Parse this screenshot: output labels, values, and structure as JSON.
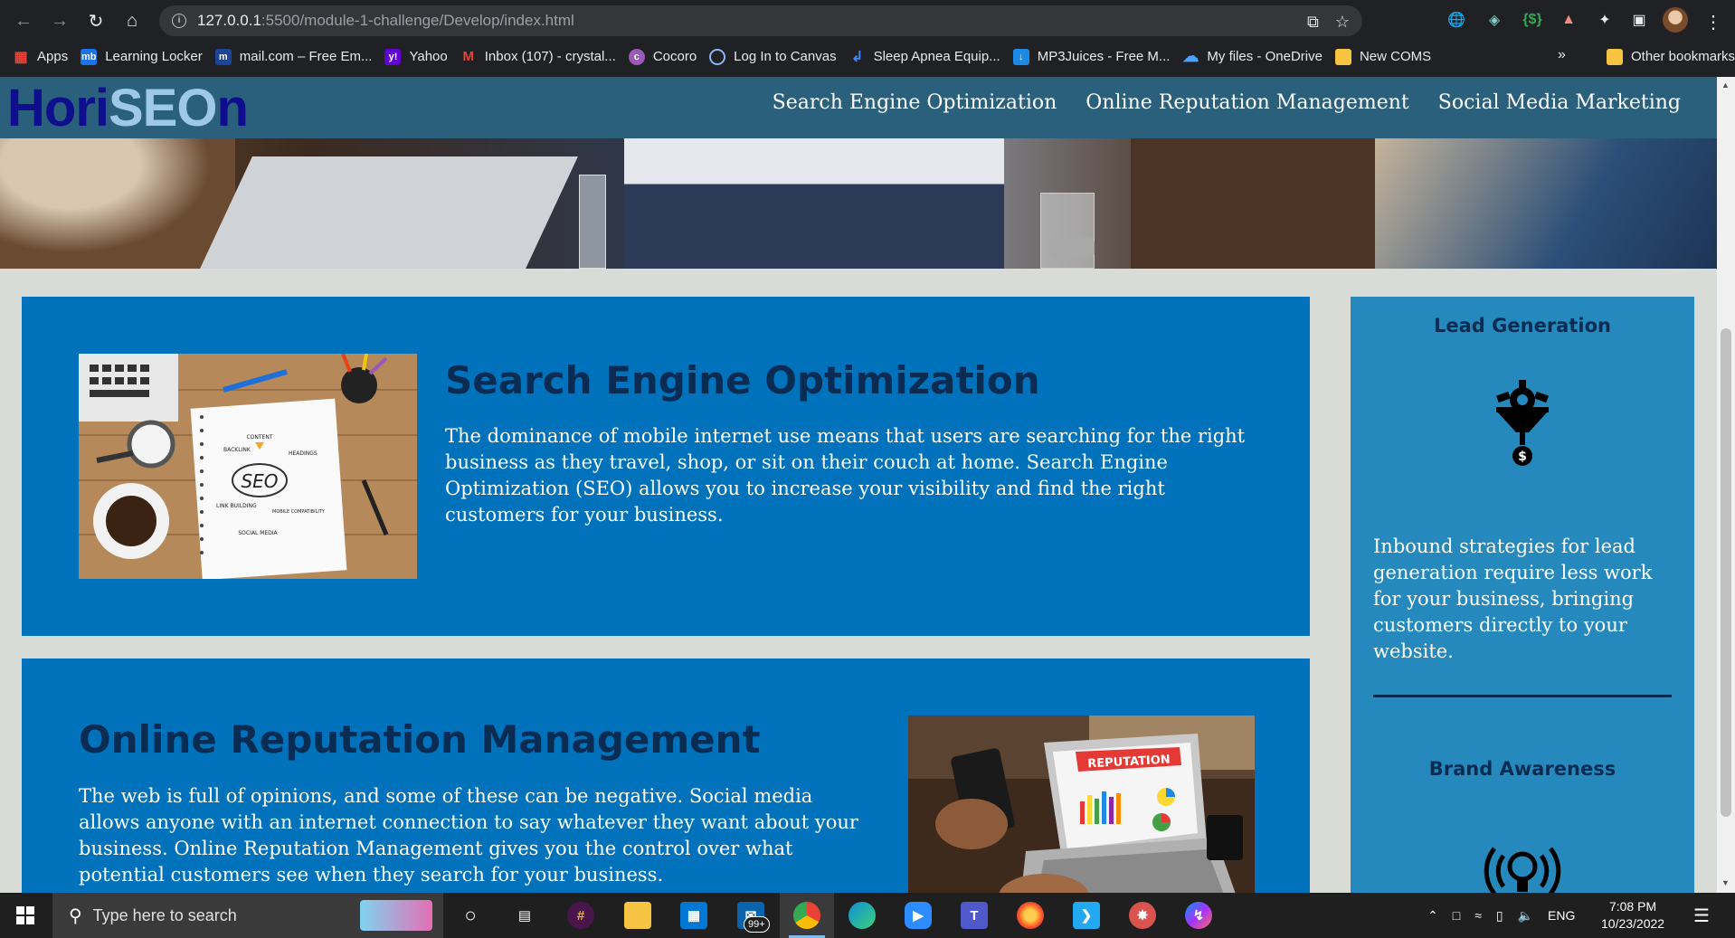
{
  "browser": {
    "url_host": "127.0.0.1",
    "url_path": ":5500/module-1-challenge/Develop/index.html",
    "bookmarks": [
      {
        "label": "Apps",
        "icon": "apps-grid-icon",
        "color": "#ea4335"
      },
      {
        "label": "Learning Locker",
        "icon": "mb-icon",
        "color": "#1a73e8"
      },
      {
        "label": "mail.com – Free Em...",
        "icon": "mailcom-icon",
        "color": "#1c449b"
      },
      {
        "label": "Yahoo",
        "icon": "yahoo-icon",
        "color": "#6001d2"
      },
      {
        "label": "Inbox (107) - crystal...",
        "icon": "gmail-icon",
        "color": "#ea4335"
      },
      {
        "label": "Cocoro",
        "icon": "cocoro-icon",
        "color": "#9b59b6"
      },
      {
        "label": "Log In to Canvas",
        "icon": "canvas-icon",
        "color": "#5f8dc8"
      },
      {
        "label": "Sleep Apnea Equip...",
        "icon": "sleep-icon",
        "color": "#1565c0"
      },
      {
        "label": "MP3Juices - Free M...",
        "icon": "download-icon",
        "color": "#1e88e5"
      },
      {
        "label": "My files - OneDrive",
        "icon": "onedrive-icon",
        "color": "#0a78d4"
      },
      {
        "label": "New COMS",
        "icon": "folder-icon",
        "color": "#f6c343"
      }
    ],
    "overflow_label": "»",
    "other_bookmarks": "Other bookmarks"
  },
  "site": {
    "logo_pre": "Hori",
    "logo_seo": "SEO",
    "logo_post": "n",
    "nav": [
      "Search Engine Optimization",
      "Online Reputation Management",
      "Social Media Marketing"
    ]
  },
  "sections": [
    {
      "title": "Search Engine Optimization",
      "text": "The dominance of mobile internet use means that users are searching for the right business as they travel, shop, or sit on their couch at home. Search Engine Optimization (SEO) allows you to increase your visibility and find the right customers for your business.",
      "image_labels": {
        "center": "SEO",
        "content": "CONTENT",
        "backlink": "BACKLINK",
        "headings": "HEADINGS",
        "linkbuilding": "LINK BUILDING",
        "mobile": "MOBILE COMPATIBILITY",
        "social": "SOCIAL MEDIA"
      }
    },
    {
      "title": "Online Reputation Management",
      "text": "The web is full of opinions, and some of these can be negative. Social media allows anyone with an internet connection to say whatever they want about your business. Online Reputation Management gives you the control over what potential customers see when they search for your business.",
      "image_labels": {
        "banner": "REPUTATION"
      }
    }
  ],
  "aside": {
    "items": [
      {
        "title": "Lead Generation",
        "text": "Inbound strategies for lead generation require less work for your business, bringing customers directly to your website."
      },
      {
        "title": "Brand Awareness"
      }
    ]
  },
  "taskbar": {
    "search_placeholder": "Type here to search",
    "mail_badge": "99+",
    "lang": "ENG",
    "time": "7:08 PM",
    "date": "10/23/2022"
  }
}
